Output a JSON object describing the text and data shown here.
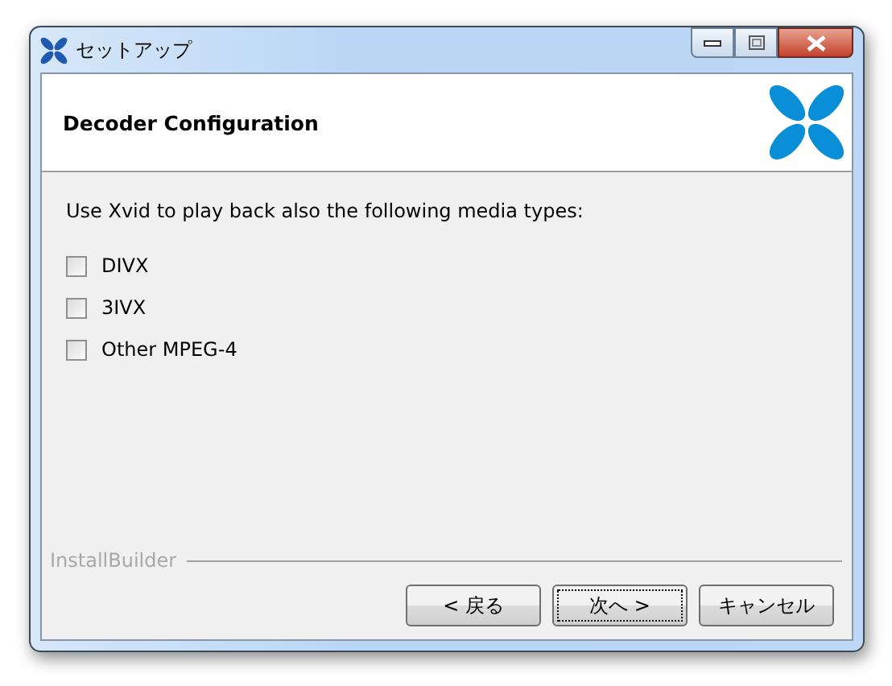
{
  "window": {
    "title": "セットアップ"
  },
  "header": {
    "title": "Decoder Configuration"
  },
  "body": {
    "prompt": "Use Xvid to play back also the following media types:",
    "options": [
      {
        "label": "DIVX",
        "checked": false
      },
      {
        "label": "3IVX",
        "checked": false
      },
      {
        "label": "Other MPEG-4",
        "checked": false
      }
    ]
  },
  "branding": "InstallBuilder",
  "buttons": [
    {
      "label": "< 戻る",
      "focused": false
    },
    {
      "label": "次へ >",
      "focused": true
    },
    {
      "label": "キャンセル",
      "focused": false
    }
  ]
}
